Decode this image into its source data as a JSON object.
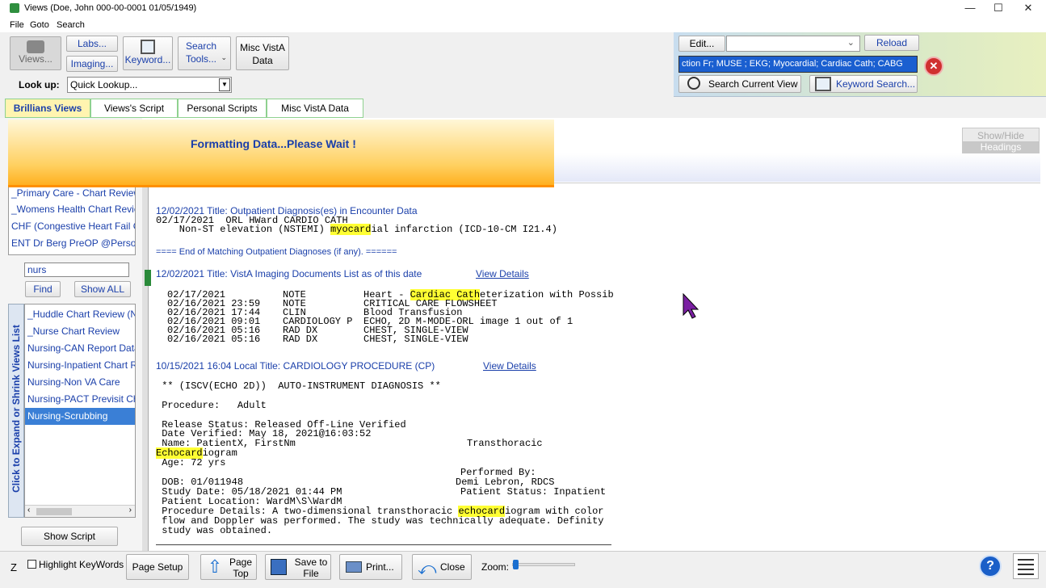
{
  "window": {
    "title": "Views (Doe, John  000-00-0001  01/05/1949)"
  },
  "menu": [
    "File",
    "Goto",
    "Search"
  ],
  "toolbar": {
    "views_label": "Views...",
    "labs_label": "Labs...",
    "imaging_label": "Imaging...",
    "keyword_label": "Keyword...",
    "search_tools_label": "Search Tools...",
    "misc_vista_label_1": "Misc VistA",
    "misc_vista_label_2": "Data",
    "lookup_label": "Look up:",
    "lookup_value": "Quick Lookup..."
  },
  "right_panel": {
    "edit_label": "Edit...",
    "reload_label": "Reload",
    "search_text": "ction Fr; MUSE ; EKG; Myocardial; Cardiac Cath; CABG",
    "search_current_label": "Search Current View",
    "keyword_search_label": "Keyword Search..."
  },
  "tabs": [
    "Brillians Views",
    "Views's Script",
    "Personal Scripts",
    "Misc VistA Data"
  ],
  "waiting": "Formatting Data...Please Wait !",
  "show_hide": [
    "Show/Hide",
    "Headings"
  ],
  "left": {
    "top_list": [
      "_Primary Care - Chart Review",
      "_Womens Health Chart Review",
      "CHF (Congestive Heart Fail C",
      "ENT Dr Berg PreOP @Person"
    ],
    "filter_value": "nurs",
    "find_label": "Find",
    "show_all_label": "Show ALL",
    "vertical_label": "Click to Expand or Shrink Views List",
    "views_list": [
      "_Huddle Chart Review (N",
      "_Nurse Chart Review",
      "Nursing-CAN Report Data",
      "Nursing-Inpatient Chart R",
      "Nursing-Non VA Care",
      "Nursing-PACT Previsit Ch",
      "Nursing-Scrubbing"
    ],
    "show_script_label": "Show Script"
  },
  "content": {
    "h1": "12/02/2021  Title:  Outpatient Diagnosis(es) in Encounter Data",
    "m1a": "02/17/2021  ORL HWard CARDIO CATH",
    "m1b_pre": "    Non-ST elevation (NSTEMI) ",
    "m1b_hl": "myocard",
    "m1b_post": "ial infarction (ICD-10-CM I21.4)",
    "end_line": "==== End of Matching Outpatient Diagnoses (if any). ======",
    "h2": "12/02/2021   Title: VistA Imaging Documents List as of this date",
    "view_details": "View Details",
    "img_rows": [
      {
        "date": "02/17/2021",
        "type": "NOTE",
        "pre": "Heart - ",
        "hl": "Cardiac Cath",
        "post": "eterization with Possib"
      },
      {
        "date": "02/16/2021 23:59",
        "type": "NOTE",
        "pre": "CRITICAL CARE FLOWSHEET",
        "hl": "",
        "post": ""
      },
      {
        "date": "02/16/2021 17:44",
        "type": "CLIN",
        "pre": "Blood Transfusion",
        "hl": "",
        "post": ""
      },
      {
        "date": "02/16/2021 09:01",
        "type": "CARDIOLOGY P",
        "pre": "ECHO, 2D M-MODE-ORL image 1 out of 1",
        "hl": "",
        "post": ""
      },
      {
        "date": "02/16/2021 05:16",
        "type": "RAD DX",
        "pre": "CHEST, SINGLE-VIEW",
        "hl": "",
        "post": ""
      },
      {
        "date": "02/16/2021 05:16",
        "type": "RAD DX",
        "pre": "CHEST, SINGLE-VIEW",
        "hl": "",
        "post": ""
      }
    ],
    "h3": "10/15/2021 16:04  Local Title: CARDIOLOGY PROCEDURE (CP)",
    "r1": " ** (ISCV(ECHO 2D))  AUTO-INSTRUMENT DIAGNOSIS **",
    "r2": " Procedure:   Adult",
    "r3": " Release Status: Released Off-Line Verified",
    "r4": " Date Verified: May 18, 2021@16:03:52",
    "r5a": " Name: PatientX, FirstNm",
    "r5b": "Transthoracic",
    "r6_hl": "Echocard",
    "r6_post": "iogram",
    "r7": " Age: 72 yrs",
    "r8": "Performed By:",
    "r9a": " DOB: 01/011948",
    "r9b": "Demi Lebron, RDCS",
    "r10a": " Study Date: 05/18/2021 01:44 PM",
    "r10b": "Patient Status: Inpatient",
    "r11": " Patient Location: WardM\\S\\WardM",
    "r12_pre": " Procedure Details: A two-dimensional transthoracic ",
    "r12_hl": "echocard",
    "r12_post": "iogram with color",
    "r13": " flow and Doppler was performed. The study was technically adequate. Definity",
    "r14": " study was obtained."
  },
  "bottom": {
    "z": "Z",
    "highlight_label": "Highlight KeyWords",
    "page_setup_label": "Page Setup",
    "page_top_1": "Page",
    "page_top_2": "Top",
    "save_1": "Save to",
    "save_2": "File",
    "print_label": "Print...",
    "close_label": "Close",
    "zoom_label": "Zoom:"
  },
  "colors": {
    "accent": "#1a3faa",
    "highlight": "#ffff33",
    "selected": "#3a7fd6",
    "tab_border": "#8fd18f"
  }
}
